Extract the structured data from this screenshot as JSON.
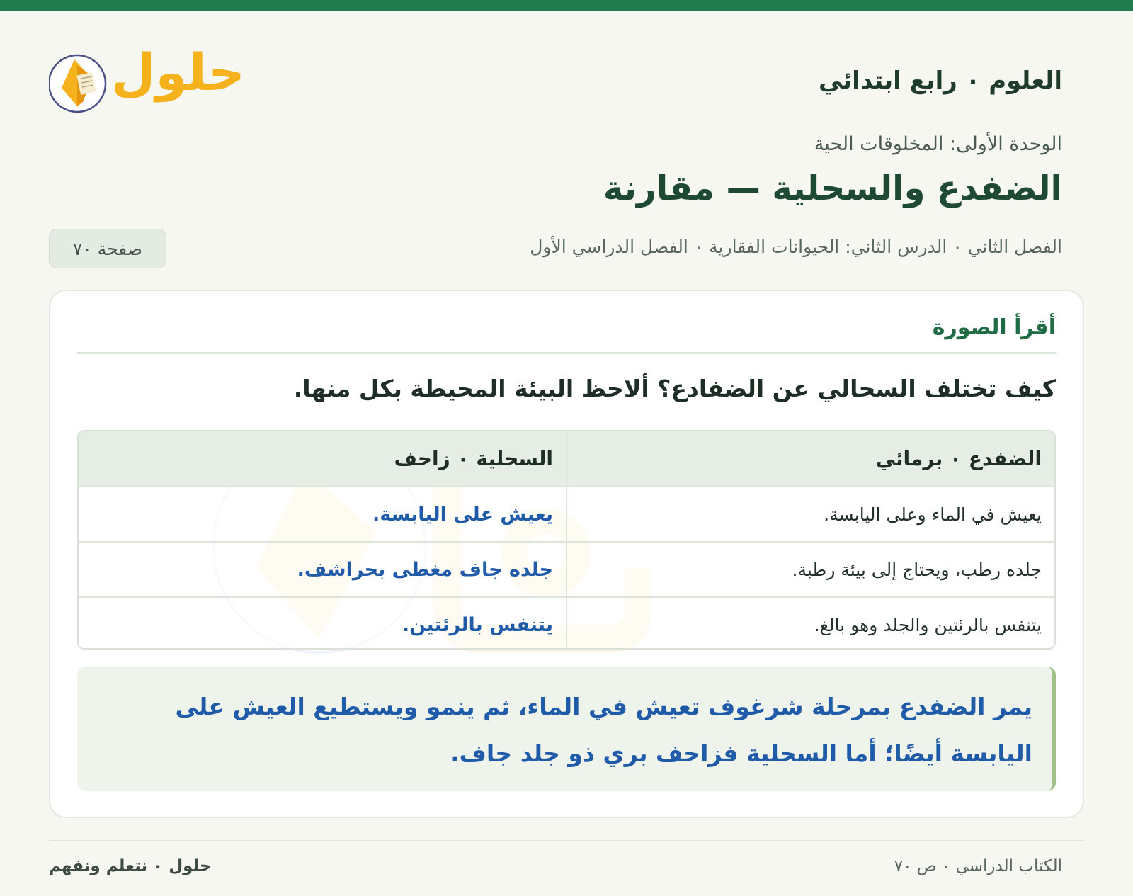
{
  "header": {
    "subject": "العلوم ٠ رابع ابتدائي",
    "logo_text": "حلول"
  },
  "lesson": {
    "unit": "الوحدة الأولى: المخلوقات الحية",
    "title": "الضفدع والسحلية — مقارنة",
    "meta": "الفصل الثاني ٠ الدرس الثاني: الحيوانات الفقارية ٠ الفصل الدراسي الأول",
    "page_badge": "صفحة ٧٠"
  },
  "card": {
    "section_label": "أقرأ الصورة",
    "question": "كيف تختلف السحالي عن الضفادع؟ ألاحظ البيئة المحيطة بكل منها.",
    "table": {
      "headers": [
        "الضفدع ٠ برمائي",
        "السحلية ٠ زاحف"
      ],
      "rows": [
        [
          "يعيش في الماء وعلى اليابسة.",
          "يعيش على اليابسة."
        ],
        [
          "جلده رطب، ويحتاج إلى بيئة رطبة.",
          "جلده جاف مغطى بحراشف."
        ],
        [
          "يتنفس بالرئتين والجلد وهو بالغ.",
          "يتنفس بالرئتين."
        ]
      ]
    },
    "note": "يمر الضفدع بمرحلة شرغوف تعيش في الماء، ثم ينمو ويستطيع العيش على اليابسة أيضًا؛ أما السحلية فزاحف بري ذو جلد جاف."
  },
  "footer": {
    "left": "حلول ٠ نتعلم ونفهم",
    "right": "الكتاب الدراسي ٠ ص ٧٠"
  },
  "colors": {
    "accent_green": "#1f7a4c",
    "answer_blue": "#1f5ba8",
    "logo_gold": "#f5b21c"
  }
}
